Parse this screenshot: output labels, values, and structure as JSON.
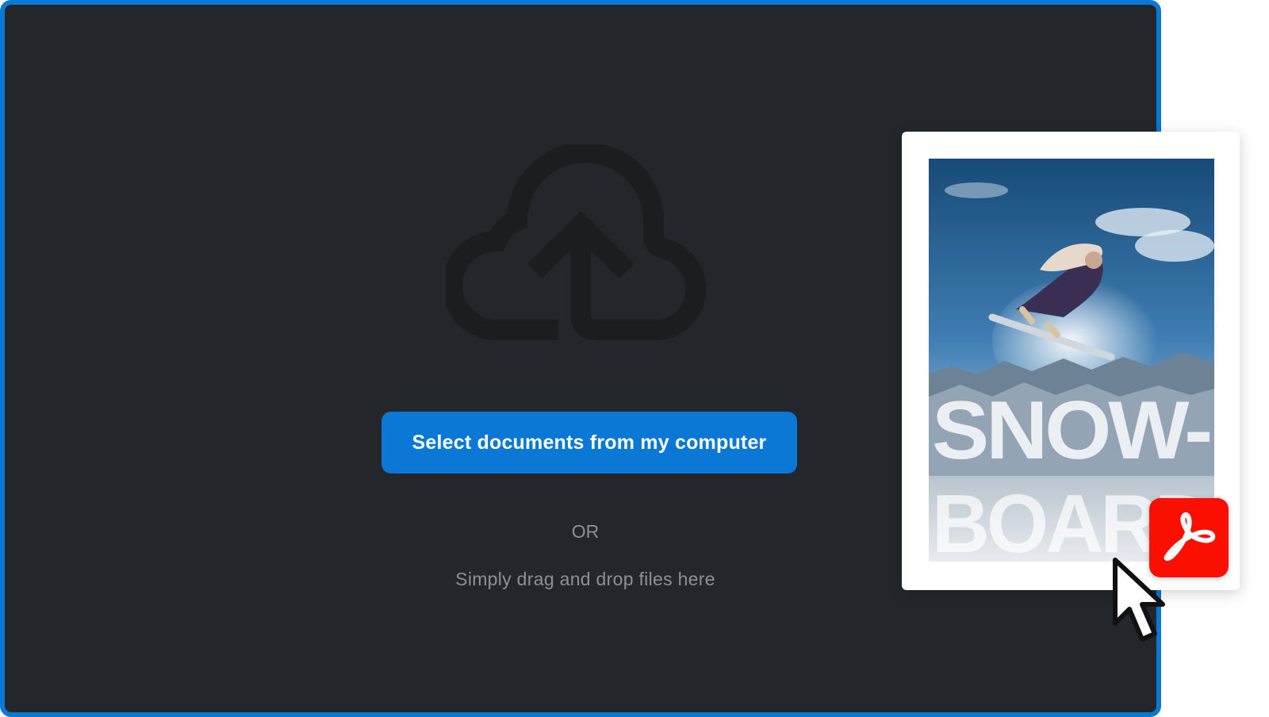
{
  "dropzone": {
    "button_label": "Select documents from my computer",
    "or_label": "OR",
    "drag_hint": "Simply drag and drop files here"
  },
  "preview": {
    "poster_line1": "SNOW-",
    "poster_line2": "BOARD"
  },
  "icons": {
    "upload": "cloud-upload-icon",
    "badge": "acrobat-pdf-icon",
    "pointer": "mouse-pointer-icon"
  },
  "colors": {
    "accent": "#0a78d4",
    "background": "#23272b",
    "muted_text": "#8d9095",
    "pdf_red": "#fa0f00"
  }
}
